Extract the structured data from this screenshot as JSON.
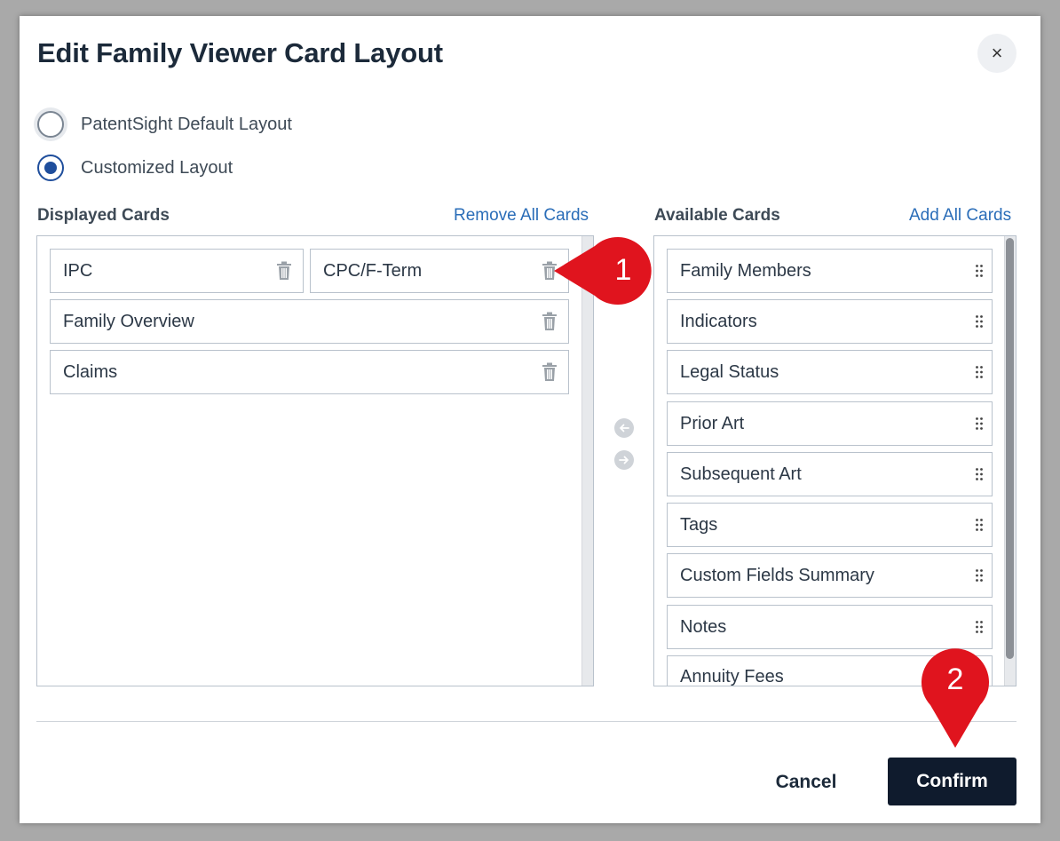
{
  "dialog": {
    "title": "Edit Family Viewer Card Layout",
    "close_icon": "×"
  },
  "layout_options": [
    {
      "label": "PatentSight Default Layout",
      "selected": false
    },
    {
      "label": "Customized Layout",
      "selected": true
    }
  ],
  "displayed": {
    "heading": "Displayed Cards",
    "action": "Remove All Cards",
    "cards": [
      "IPC",
      "CPC/F-Term",
      "Family Overview",
      "Claims"
    ]
  },
  "available": {
    "heading": "Available Cards",
    "action": "Add All Cards",
    "cards": [
      "Family Members",
      "Indicators",
      "Legal Status",
      "Prior Art",
      "Subsequent Art",
      "Tags",
      "Custom Fields Summary",
      "Notes",
      "Annuity Fees"
    ]
  },
  "footer": {
    "cancel_label": "Cancel",
    "confirm_label": "Confirm"
  },
  "callouts": {
    "one": "1",
    "two": "2",
    "color": "#e0141e"
  },
  "colors": {
    "primary_button": "#0f1b2d",
    "link": "#2a6db8",
    "radio_selected": "#1f4e9c"
  }
}
